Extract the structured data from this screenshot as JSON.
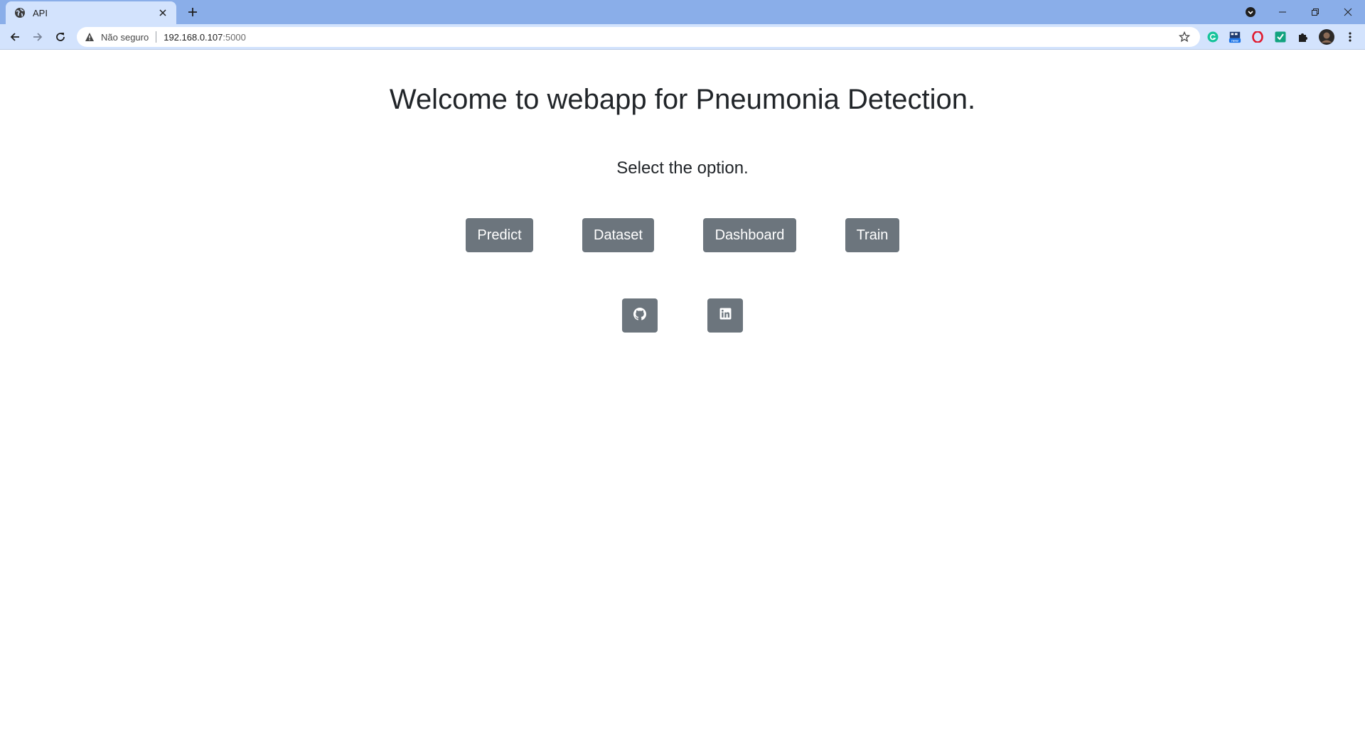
{
  "browser": {
    "tab": {
      "title": "API",
      "favicon": "globe-icon"
    },
    "address_bar": {
      "security_label": "Não seguro",
      "url_host": "192.168.0.107",
      "url_port": ":5000"
    }
  },
  "page": {
    "title": "Welcome to webapp for Pneumonia Detection.",
    "subtitle": "Select the option.",
    "buttons": [
      {
        "label": "Predict"
      },
      {
        "label": "Dataset"
      },
      {
        "label": "Dashboard"
      },
      {
        "label": "Train"
      }
    ],
    "social": [
      {
        "icon": "github-icon"
      },
      {
        "icon": "linkedin-icon"
      }
    ]
  },
  "colors": {
    "button_bg": "#6c757d",
    "heading_text": "#212529",
    "tabstrip_bg": "#8aaee9",
    "toolbar_bg": "#d3e3fd"
  }
}
